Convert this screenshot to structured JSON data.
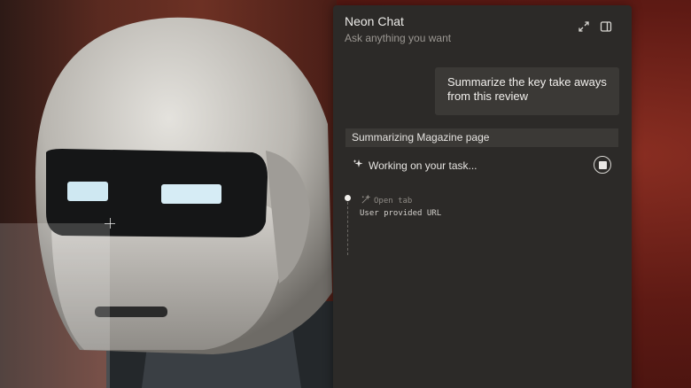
{
  "chat": {
    "title": "Neon Chat",
    "subtitle": "Ask anything you want",
    "user_message": "Summarize the key take aways from this review",
    "task_label": "Summarizing Magazine page",
    "status_text": "Working on your task...",
    "steps": [
      {
        "action": "Open tab",
        "detail": "User provided URL"
      }
    ]
  },
  "icons": {
    "expand": "expand-icon",
    "sidepanel": "side-panel-icon",
    "sparkle": "sparkle-icon",
    "stop": "stop-icon",
    "open_tab": "wand-icon"
  },
  "colors": {
    "panel_bg": "#2c2a28",
    "bubble_bg": "#3b3936",
    "background_red": "#6d2018"
  }
}
